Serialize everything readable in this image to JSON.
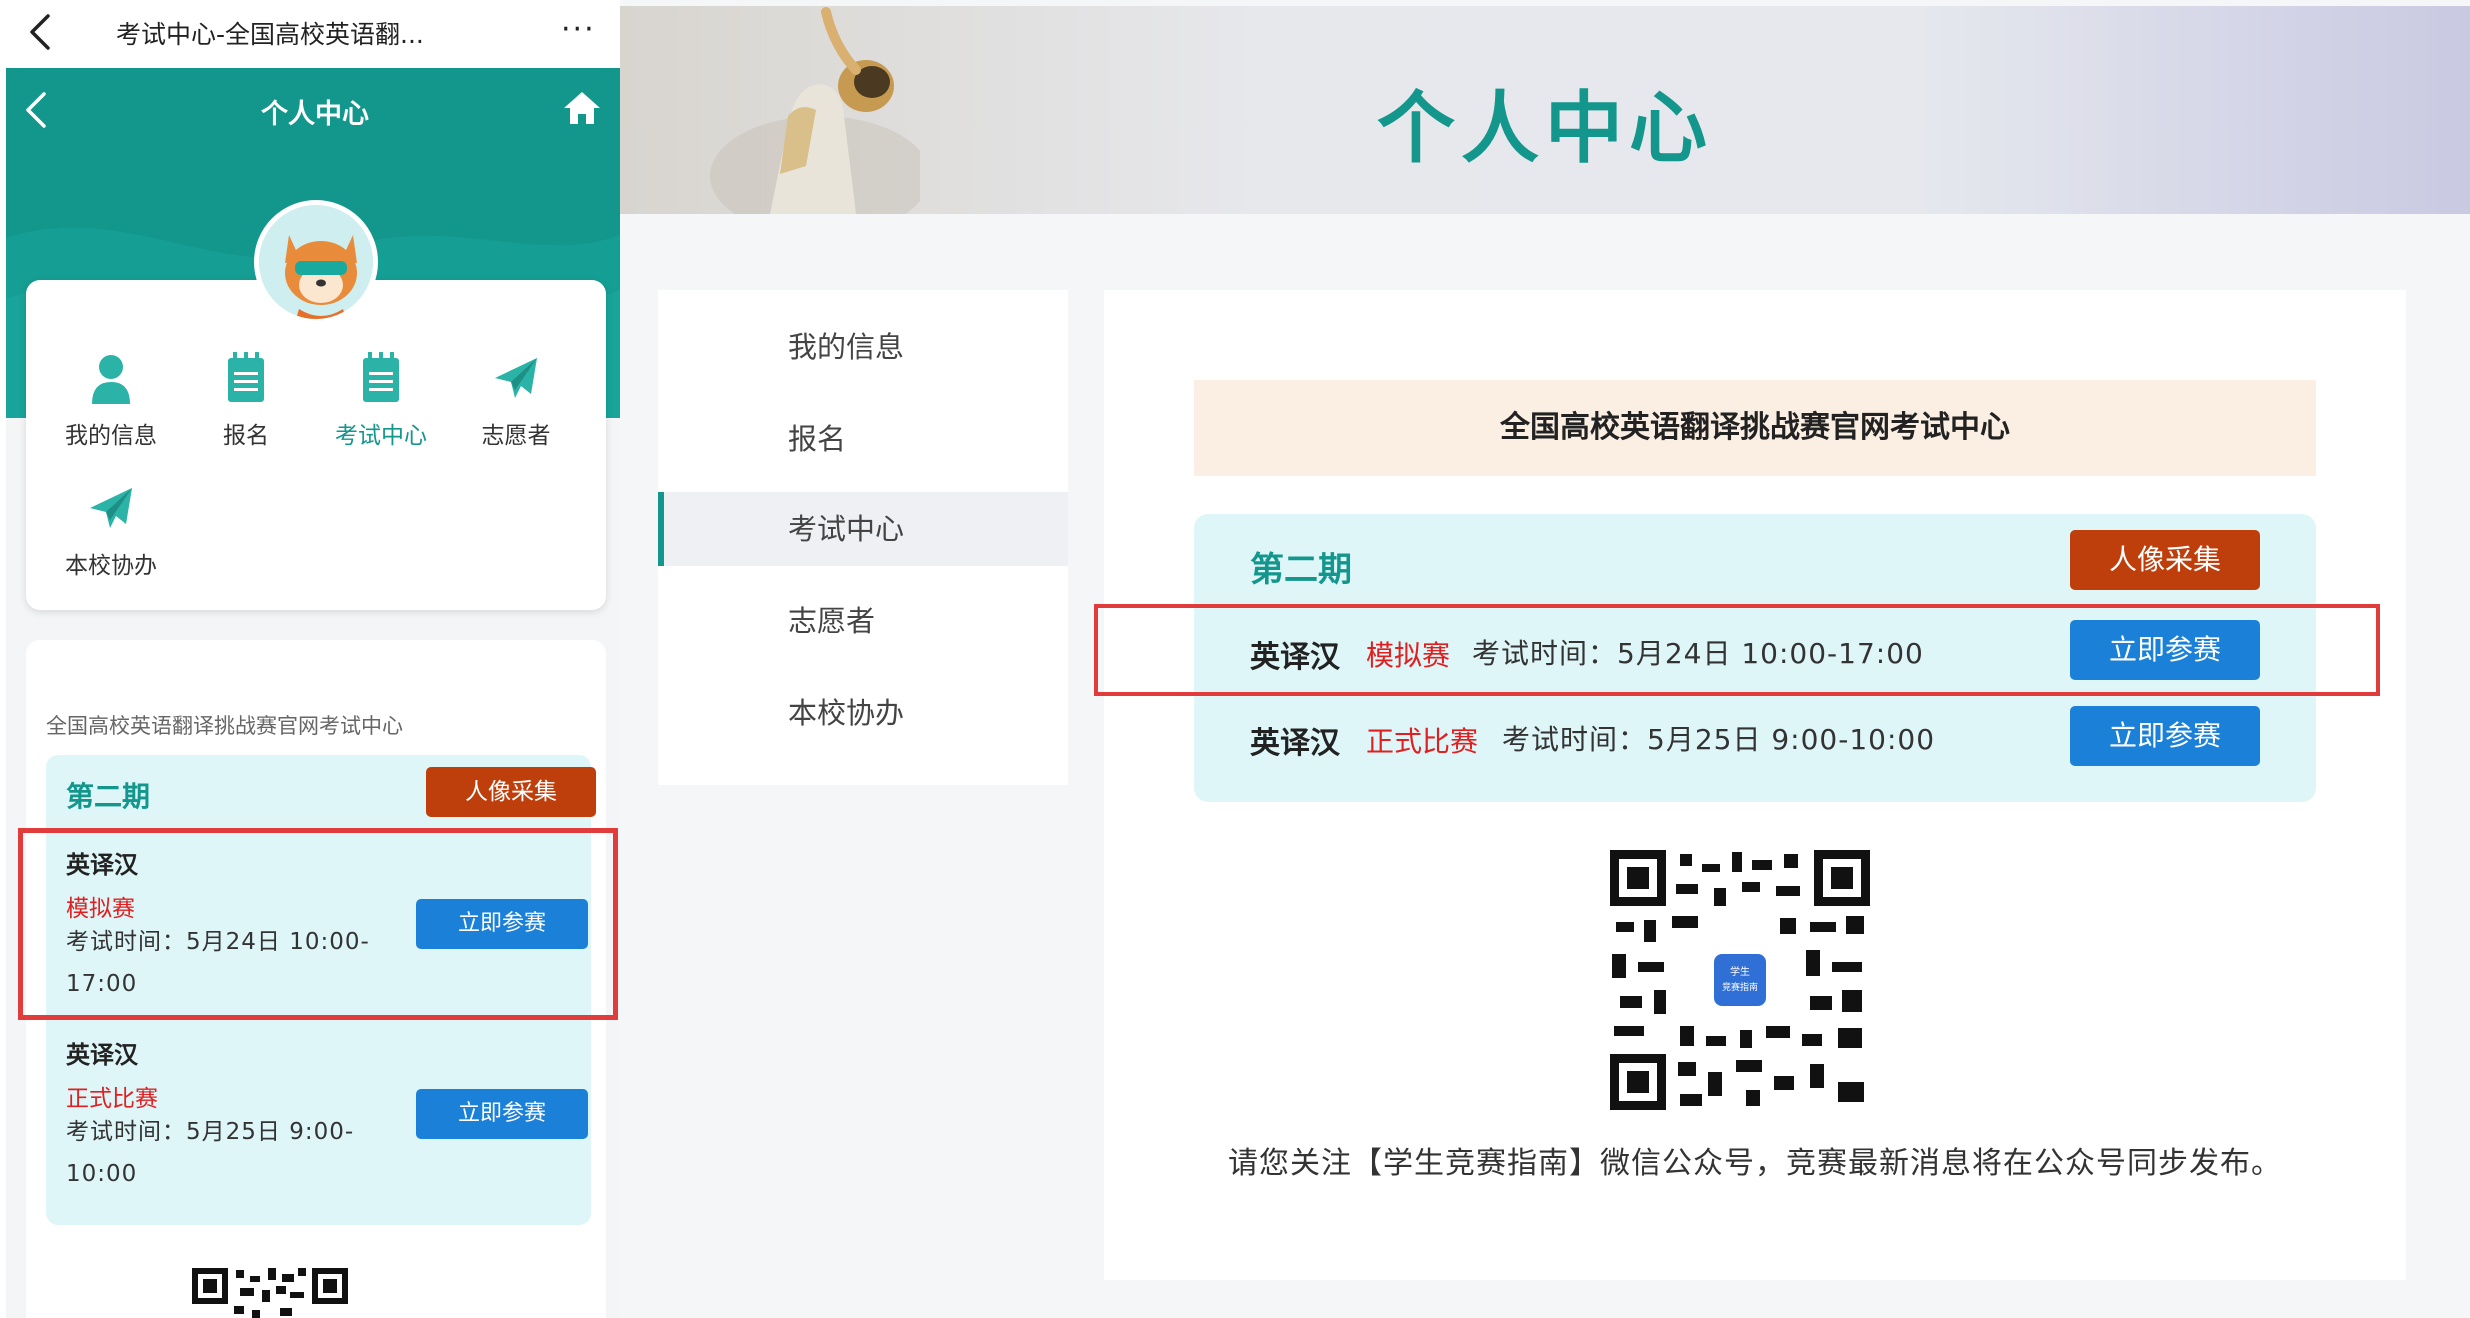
{
  "colors": {
    "brand": "#13968c",
    "photo_button": "#bf3f0c",
    "join_button": "#1a80d8",
    "warning_text": "#e02020",
    "highlight": "#e03c3c"
  },
  "mobile": {
    "window_title": "考试中心-全国高校英语翻...",
    "more_label": "···",
    "header_title": "个人中心",
    "nav": [
      {
        "label": "我的信息",
        "icon": "user-icon"
      },
      {
        "label": "报名",
        "icon": "notepad-icon"
      },
      {
        "label": "考试中心",
        "icon": "notepad-icon",
        "active": true
      },
      {
        "label": "志愿者",
        "icon": "paper-plane-icon"
      },
      {
        "label": "本校协办",
        "icon": "paper-plane-icon"
      }
    ],
    "site_name": "全国高校英语翻译挑战赛官网考试中心",
    "period": "第二期",
    "photo_button": "人像采集",
    "exams": [
      {
        "name": "英译汉",
        "type": "模拟赛",
        "time": "考试时间：5月24日 10:00-17:00",
        "button": "立即参赛"
      },
      {
        "name": "英译汉",
        "type": "正式比赛",
        "time": "考试时间：5月25日 9:00-10:00",
        "button": "立即参赛"
      }
    ]
  },
  "desktop": {
    "banner_title": "个人中心",
    "sidebar": [
      {
        "label": "我的信息"
      },
      {
        "label": "报名"
      },
      {
        "label": "考试中心",
        "active": true
      },
      {
        "label": "志愿者"
      },
      {
        "label": "本校协办"
      }
    ],
    "heading": "全国高校英语翻译挑战赛官网考试中心",
    "period": "第二期",
    "photo_button": "人像采集",
    "exams": [
      {
        "name": "英译汉",
        "type": "模拟赛",
        "time": "考试时间：5月24日 10:00-17:00",
        "button": "立即参赛"
      },
      {
        "name": "英译汉",
        "type": "正式比赛",
        "time": "考试时间：5月25日 9:00-10:00",
        "button": "立即参赛"
      }
    ],
    "qr_logo_text": "学生竞赛指南",
    "follow_text": "请您关注【学生竞赛指南】微信公众号，竞赛最新消息将在公众号同步发布。"
  }
}
